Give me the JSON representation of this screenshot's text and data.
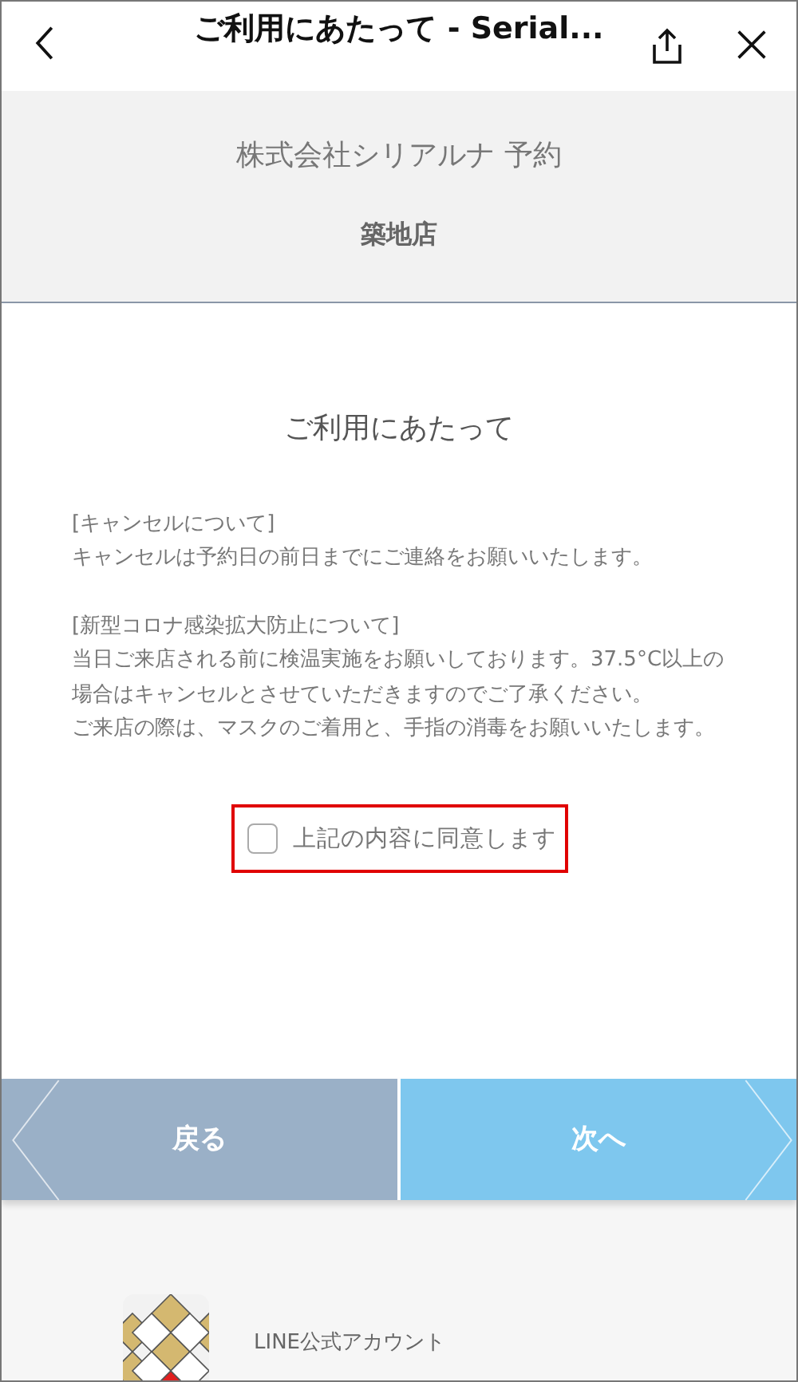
{
  "header": {
    "title": "ご利用にあたって - Serial..."
  },
  "banner": {
    "company": "株式会社シリアルナ 予約",
    "store": "築地店"
  },
  "page_title": "ご利用にあたって",
  "notices": [
    {
      "heading": "[キャンセルについて]",
      "paragraphs": [
        "キャンセルは予約日の前日までにご連絡をお願いいたします。"
      ]
    },
    {
      "heading": "[新型コロナ感染拡大防止について]",
      "paragraphs": [
        "当日ご来店される前に検温実施をお願いしております。37.5°C以上の場合はキャンセルとさせていただきますのでご了承ください。",
        "ご来店の際は、マスクのご着用と、手指の消毒をお願いいたします。"
      ]
    }
  ],
  "agree": {
    "label": "上記の内容に同意します",
    "checked": false,
    "highlighted": true
  },
  "buttons": [
    {
      "label": "戻る",
      "kind": "back"
    },
    {
      "label": "次へ",
      "kind": "next"
    }
  ],
  "footer": {
    "label": "LINE公式アカウント"
  }
}
